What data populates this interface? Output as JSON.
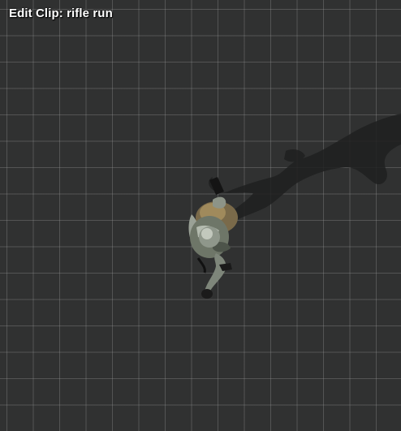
{
  "viewport": {
    "title": "Edit Clip: rifle run",
    "background_color": "#303131",
    "grid_color": "#8a8a8a",
    "shadow_color": "#1e1f1f"
  }
}
